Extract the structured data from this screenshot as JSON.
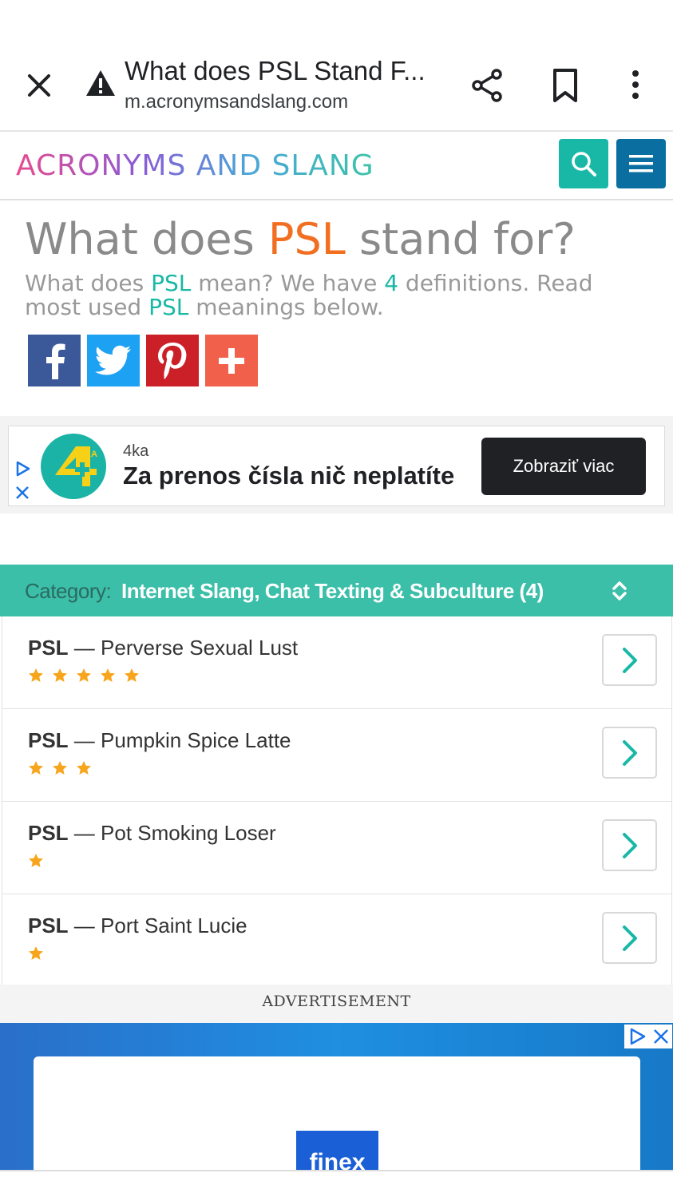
{
  "browser": {
    "title": "What does PSL Stand F...",
    "url": "m.acronymsandslang.com"
  },
  "site": {
    "logo": "ACRONYMS AND SLANG"
  },
  "heading": {
    "prefix": "What does ",
    "acronym": "PSL",
    "suffix": " stand for?"
  },
  "subtitle": {
    "part1": "What does ",
    "acronym1": "PSL",
    "part2": " mean? We have ",
    "count": "4",
    "part3": " definitions. Read most used ",
    "acronym2": "PSL",
    "part4": " meanings below."
  },
  "ad1": {
    "brand": "4ka",
    "headline": "Za prenos čísla nič neplatíte",
    "button": "Zobraziť viac",
    "logo_text": "4",
    "logo_small": "KA"
  },
  "category": {
    "label": "Category:",
    "value": "Internet Slang, Chat Texting & Subculture (4)"
  },
  "definitions": [
    {
      "acronym": "PSL",
      "separator": " — ",
      "meaning": "Perverse Sexual Lust",
      "stars": 5
    },
    {
      "acronym": "PSL",
      "separator": " — ",
      "meaning": "Pumpkin Spice Latte",
      "stars": 3
    },
    {
      "acronym": "PSL",
      "separator": " — ",
      "meaning": "Pot Smoking Loser",
      "stars": 1
    },
    {
      "acronym": "PSL",
      "separator": " — ",
      "meaning": "Port Saint Lucie",
      "stars": 1
    }
  ],
  "advertisement": {
    "label": "ADVERTISEMENT",
    "logo_text": "finex"
  },
  "colors": {
    "accent_orange": "#f26f21",
    "teal": "#19b8a6",
    "category_bg": "#3cbfa9",
    "menu_blue": "#0a6fa0",
    "star": "#f7a51c"
  },
  "icons": [
    "close-icon",
    "warning-icon",
    "share-icon",
    "bookmark-icon",
    "more-vert-icon",
    "search-icon",
    "menu-icon",
    "facebook-icon",
    "twitter-icon",
    "pinterest-icon",
    "plus-icon",
    "chevron-right-icon",
    "sort-icon",
    "star-icon",
    "adchoices-icon"
  ]
}
